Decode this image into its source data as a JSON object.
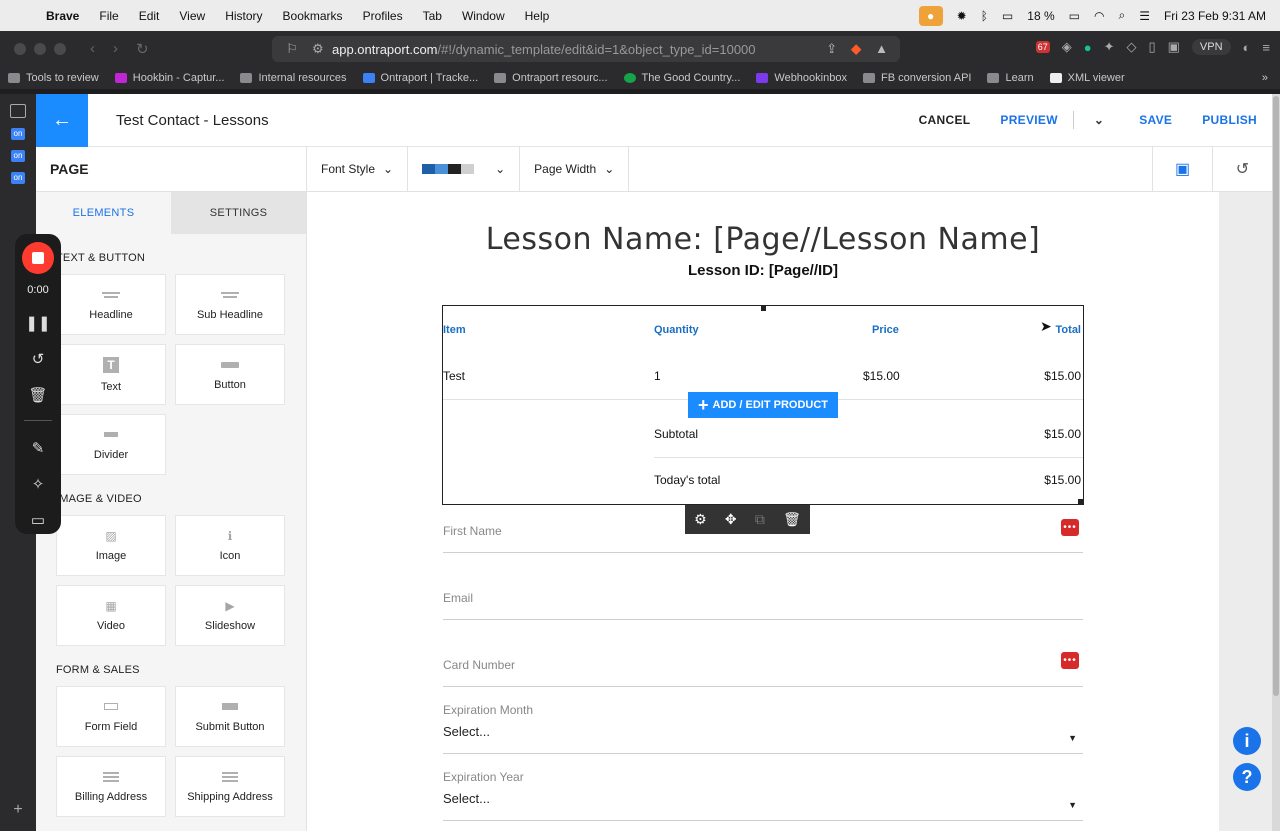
{
  "menubar": {
    "app": "Brave",
    "items": [
      "File",
      "Edit",
      "View",
      "History",
      "Bookmarks",
      "Profiles",
      "Tab",
      "Window",
      "Help"
    ],
    "battery": "18 %",
    "datetime": "Fri 23 Feb  9:31 AM"
  },
  "browser": {
    "url_host": "app.ontraport.com",
    "url_path": "/#!/dynamic_template/edit&id=1&object_type_id=10000",
    "badge_count": "67",
    "vpn": "VPN",
    "bookmarks": [
      {
        "label": "Tools to review",
        "icon": "folder"
      },
      {
        "label": "Hookbin - Captur...",
        "icon": "hook"
      },
      {
        "label": "Internal resources",
        "icon": "folder"
      },
      {
        "label": "Ontraport | Tracke...",
        "icon": "on"
      },
      {
        "label": "Ontraport resourc...",
        "icon": "folder"
      },
      {
        "label": "The Good Country...",
        "icon": "good"
      },
      {
        "label": "Webhookinbox",
        "icon": "wh"
      },
      {
        "label": "FB conversion API",
        "icon": "folder"
      },
      {
        "label": "Learn",
        "icon": "folder"
      },
      {
        "label": "XML viewer",
        "icon": "cb"
      }
    ]
  },
  "header": {
    "title": "Test Contact - Lessons",
    "cancel": "CANCEL",
    "preview": "PREVIEW",
    "save": "SAVE",
    "publish": "PUBLISH"
  },
  "toolbar": {
    "page_label": "PAGE",
    "font_style": "Font Style",
    "page_width": "Page Width",
    "swatches": [
      "#1f5fa8",
      "#4a90d9",
      "#222222",
      "#cfcfcf",
      "#ffffff"
    ]
  },
  "left_panel": {
    "tab_elements": "ELEMENTS",
    "tab_settings": "SETTINGS",
    "sections": [
      {
        "title": "TEXT & BUTTON",
        "items": [
          {
            "label": "Headline",
            "icon": "headline-icon"
          },
          {
            "label": "Sub Headline",
            "icon": "sub-headline-icon"
          },
          {
            "label": "Text",
            "icon": "text-icon"
          },
          {
            "label": "Button",
            "icon": "button-icon"
          },
          {
            "label": "Divider",
            "icon": "divider-icon"
          }
        ]
      },
      {
        "title": "IMAGE & VIDEO",
        "items": [
          {
            "label": "Image",
            "icon": "image-icon"
          },
          {
            "label": "Icon",
            "icon": "info-icon"
          },
          {
            "label": "Video",
            "icon": "film-icon"
          },
          {
            "label": "Slideshow",
            "icon": "slideshow-icon"
          }
        ]
      },
      {
        "title": "FORM & SALES",
        "items": [
          {
            "label": "Form Field",
            "icon": "form-field-icon"
          },
          {
            "label": "Submit Button",
            "icon": "submit-button-icon"
          },
          {
            "label": "Billing Address",
            "icon": "billing-icon"
          },
          {
            "label": "Shipping Address",
            "icon": "shipping-icon"
          }
        ]
      }
    ]
  },
  "recorder": {
    "time": "0:00"
  },
  "canvas": {
    "lesson_name": "Lesson Name: [Page//Lesson Name]",
    "lesson_id": "Lesson ID: [Page//ID]",
    "order": {
      "headers": {
        "item": "Item",
        "quantity": "Quantity",
        "price": "Price",
        "total": "Total"
      },
      "row": {
        "item": "Test",
        "quantity": "1",
        "price": "$15.00",
        "total": "$15.00"
      },
      "add_product": "ADD / EDIT PRODUCT",
      "subtotal_label": "Subtotal",
      "subtotal_value": "$15.00",
      "today_label": "Today's total",
      "today_value": "$15.00"
    },
    "fields": {
      "first_name": "First Name",
      "email": "Email",
      "card_number": "Card Number",
      "exp_month_label": "Expiration Month",
      "exp_month_value": "Select...",
      "exp_year_label": "Expiration Year",
      "exp_year_value": "Select..."
    }
  }
}
